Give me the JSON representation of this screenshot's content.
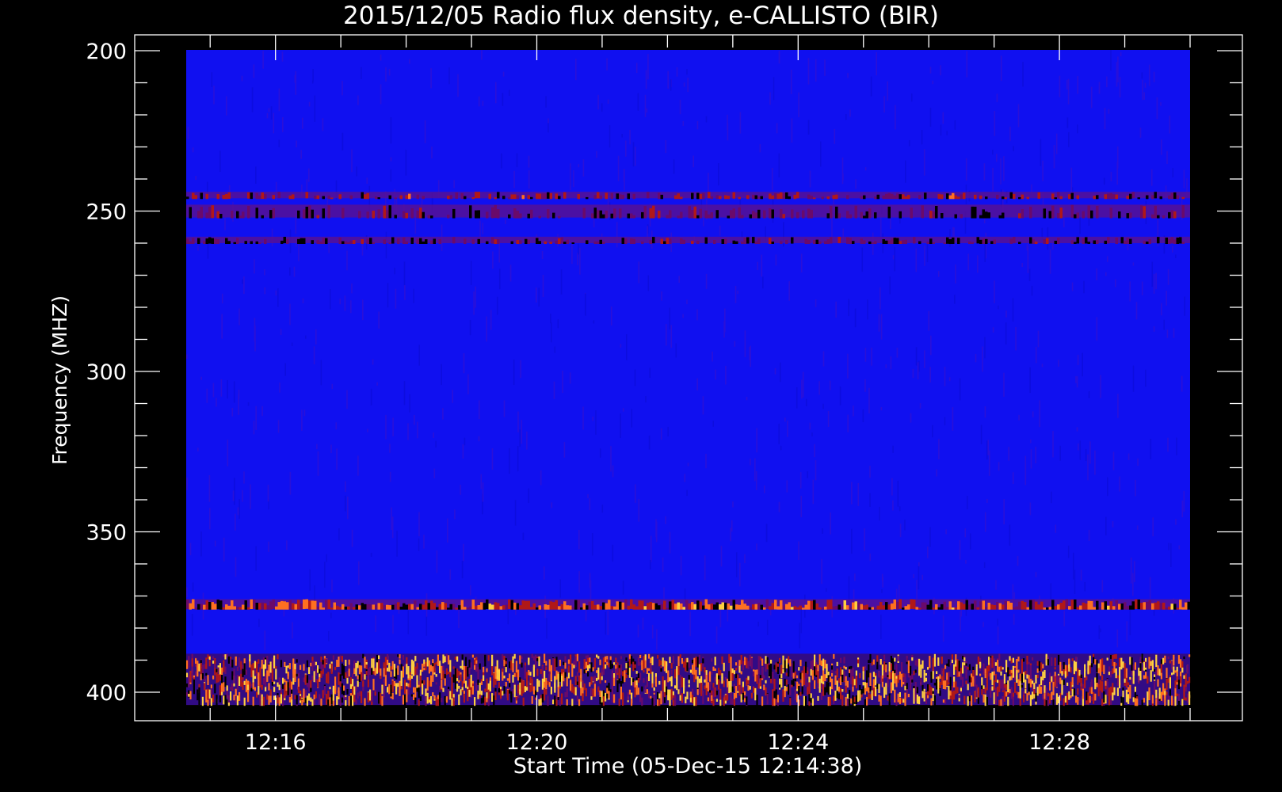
{
  "chart_data": {
    "type": "heatmap",
    "title": "2015/12/05  Radio flux density, e-CALLISTO (BIR)",
    "xlabel": "Start Time (05-Dec-15 12:14:38)",
    "ylabel": "Frequency (MHZ)",
    "x_range_minutes": [
      0,
      15.3667
    ],
    "x_start_time": "12:14:38",
    "ylim": [
      200,
      405
    ],
    "y_inverted": true,
    "x_ticks": [
      {
        "label": "12:16",
        "minute": 1.3667
      },
      {
        "label": "12:20",
        "minute": 5.3667
      },
      {
        "label": "12:24",
        "minute": 9.3667
      },
      {
        "label": "12:28",
        "minute": 13.3667
      }
    ],
    "x_minor_step_minutes": 1,
    "y_ticks": [
      {
        "label": "200",
        "value": 200
      },
      {
        "label": "250",
        "value": 250
      },
      {
        "label": "300",
        "value": 300
      },
      {
        "label": "350",
        "value": 350
      },
      {
        "label": "400",
        "value": 400
      }
    ],
    "y_minor_step": 10,
    "background_color": "#1010f0",
    "emission_bands_mhz": [
      {
        "from": 244,
        "to": 246,
        "intensity": 0.55
      },
      {
        "from": 248,
        "to": 252,
        "intensity": 0.35
      },
      {
        "from": 258,
        "to": 260,
        "intensity": 0.35
      },
      {
        "from": 371,
        "to": 374,
        "intensity": 0.8
      },
      {
        "from": 388,
        "to": 404,
        "intensity": 1.0
      }
    ],
    "colors": {
      "axes": "#ffffff",
      "low": "#1010f0",
      "mid": "#b01818",
      "high": "#ffd040",
      "min": "#000000"
    }
  }
}
